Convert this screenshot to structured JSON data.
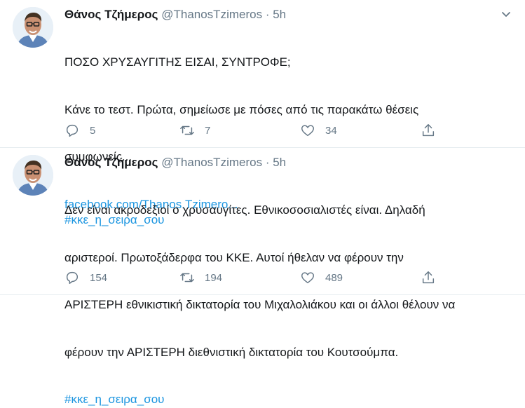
{
  "tweets": [
    {
      "name": "Θάνος Τζήμερος",
      "handle": "@ThanosTzimeros",
      "separator": "·",
      "time": "5h",
      "lines": [
        "ΠΟΣΟ ΧΡΥΣΑΥΓΙΤΗΣ ΕΙΣΑΙ, ΣΥΝΤΡΟΦΕ;",
        "Κάνε το τεστ. Πρώτα, σημείωσε με πόσες από τις παρακάτω θέσεις",
        "συμφωνείς..."
      ],
      "link": "facebook.com/Thanos.Tzimero...",
      "hashtag": "#κκε_η_σειρα_σου",
      "replies": "5",
      "retweets": "7",
      "likes": "34"
    },
    {
      "name": "Θάνος Τζήμερος",
      "handle": "@ThanosTzimeros",
      "separator": "·",
      "time": "5h",
      "lines": [
        "Δεν είναι ακροδεξιοί ο χρυσαυγίτες. Εθνικοσοσιαλιστές είναι. Δηλαδή",
        "αριστεροί. Πρωτοξάδερφα του ΚΚΕ. Αυτοί ήθελαν να φέρουν την",
        "ΑΡΙΣΤΕΡΗ εθνικιστική δικτατορία του Μιχαλολιάκου και οι άλλοι θέλουν να",
        "φέρουν την ΑΡΙΣΤΕΡΗ διεθνιστική δικτατορία του Κουτσούμπα."
      ],
      "hashtag": "#κκε_η_σειρα_σου",
      "replies": "154",
      "retweets": "194",
      "likes": "489"
    }
  ],
  "icons": {
    "reply": "reply-icon",
    "retweet": "retweet-icon",
    "like": "like-icon",
    "share": "share-icon",
    "caret": "chevron-down-icon"
  },
  "colors": {
    "link": "#1b95e0",
    "muted": "#657786",
    "text": "#14171a",
    "divider": "#e6ecf0"
  }
}
